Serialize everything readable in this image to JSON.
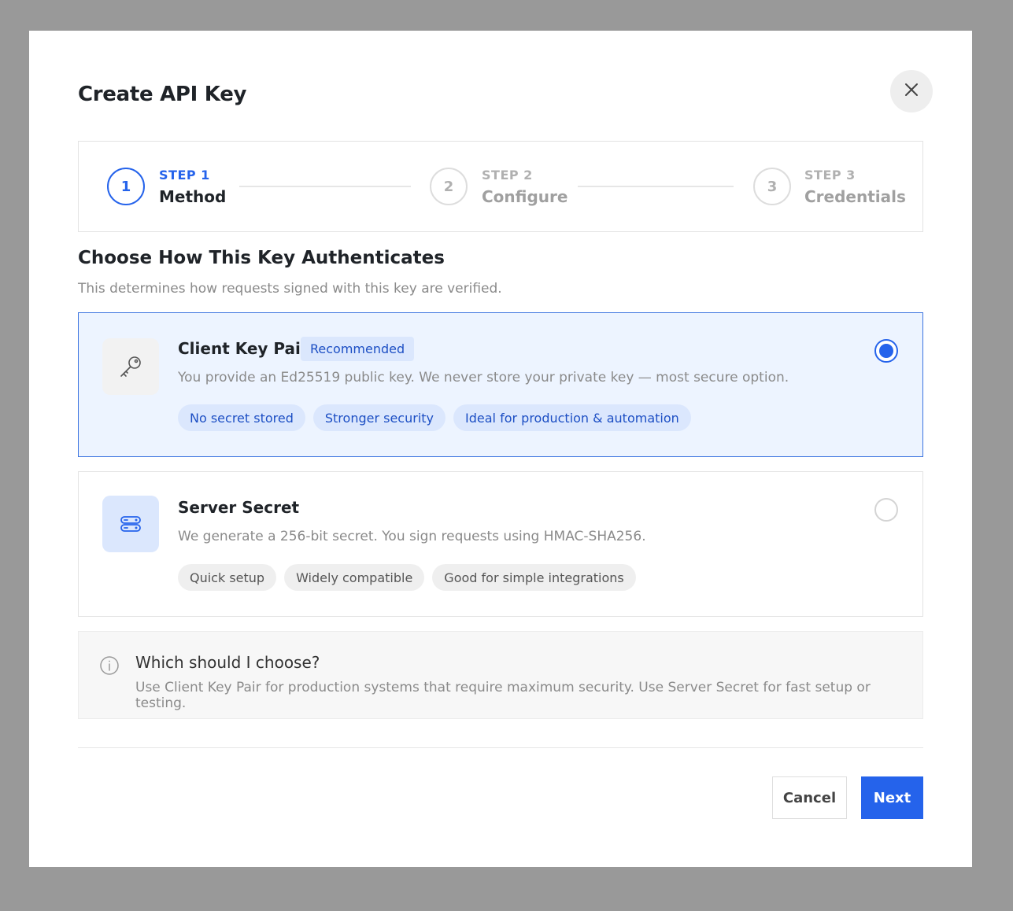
{
  "dialog": {
    "title": "Create API Key",
    "close_icon": "close-icon"
  },
  "stepper": {
    "steps": [
      {
        "number": "1",
        "label": "STEP 1",
        "name": "Method",
        "state": "active"
      },
      {
        "number": "2",
        "label": "STEP 2",
        "name": "Configure",
        "state": "inactive"
      },
      {
        "number": "3",
        "label": "STEP 3",
        "name": "Credentials",
        "state": "inactive"
      }
    ]
  },
  "section": {
    "title": "Choose How This Key Authenticates",
    "subtitle": "This determines how requests signed with this key are verified."
  },
  "options": [
    {
      "icon": "key-icon",
      "title": "Client Key Pair",
      "badge": "Recommended",
      "description": "You provide an Ed25519 public key. We never store your private key — most secure option.",
      "tags": [
        "No secret stored",
        "Stronger security",
        "Ideal for production & automation"
      ],
      "selected": true
    },
    {
      "icon": "server-icon",
      "title": "Server Secret",
      "description": "We generate a 256-bit secret. You sign requests using HMAC-SHA256.",
      "tags": [
        "Quick setup",
        "Widely compatible",
        "Good for simple integrations"
      ],
      "selected": false
    }
  ],
  "info": {
    "icon": "info-icon",
    "title": "Which should I choose?",
    "text": "Use Client Key Pair for production systems that require maximum security. Use Server Secret for fast setup or testing."
  },
  "footer": {
    "cancel_label": "Cancel",
    "next_label": "Next"
  },
  "colors": {
    "accent": "#2563eb",
    "overlay": "#999999",
    "selected_bg": "#edf4ff"
  }
}
